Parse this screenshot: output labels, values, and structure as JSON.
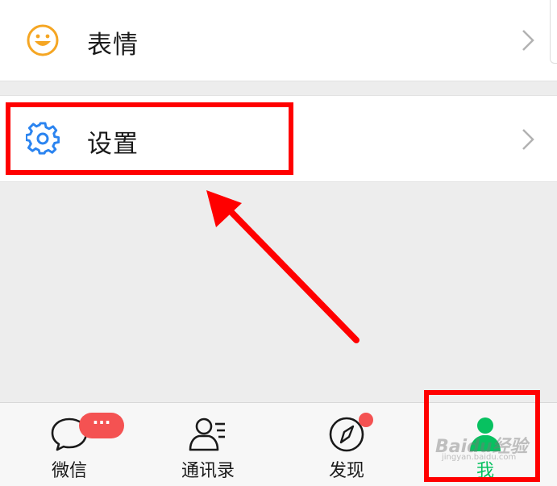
{
  "menu": {
    "emoji_row": {
      "label": "表情",
      "icon": "smiley-icon"
    },
    "settings_row": {
      "label": "设置",
      "icon": "gear-icon"
    }
  },
  "tabbar": {
    "tabs": [
      {
        "label": "微信",
        "icon": "chat-bubble-icon",
        "badge": "···"
      },
      {
        "label": "通讯录",
        "icon": "contacts-icon"
      },
      {
        "label": "发现",
        "icon": "compass-icon"
      },
      {
        "label": "我",
        "icon": "person-icon",
        "active": true
      }
    ]
  },
  "watermark": {
    "text": "Baidu经验",
    "sub": "jingyan.baidu.com"
  },
  "colors": {
    "accent_green": "#07c160",
    "badge_red": "#f45252",
    "annotation_red": "#ff0000",
    "emoji_orange": "#f5a623",
    "gear_blue": "#2b84f0"
  }
}
